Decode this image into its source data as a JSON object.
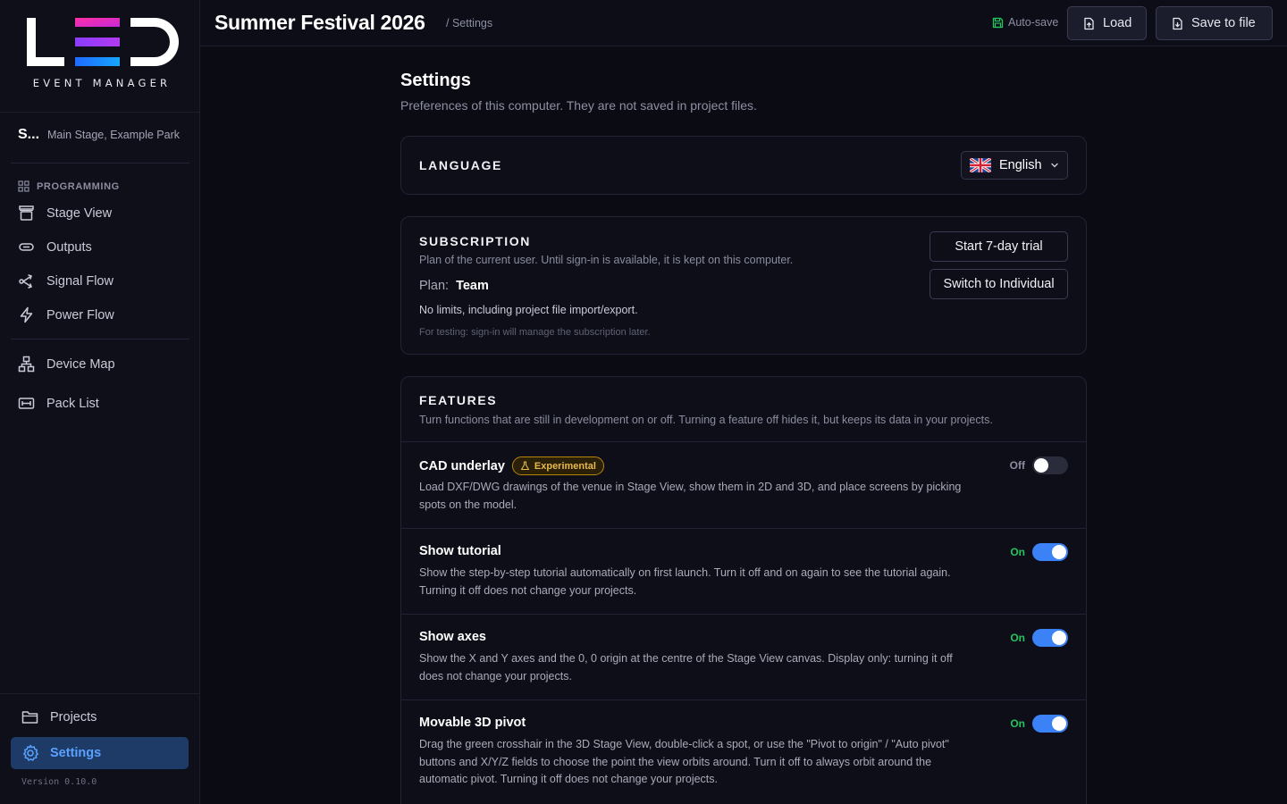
{
  "brand": {
    "logo_text": "LED",
    "logo_subtitle": "EVENT MANAGER"
  },
  "sidebar": {
    "project_name": "S...",
    "project_location": "Main Stage, Example Park",
    "section_label": "PROGRAMMING",
    "items": [
      {
        "label": "Stage View",
        "icon": "stage-icon"
      },
      {
        "label": "Outputs",
        "icon": "output-icon"
      },
      {
        "label": "Signal Flow",
        "icon": "signal-flow-icon"
      },
      {
        "label": "Power Flow",
        "icon": "lightning-icon"
      },
      {
        "label": "Device Map",
        "icon": "device-map-icon"
      },
      {
        "label": "Pack List",
        "icon": "pack-list-icon"
      }
    ],
    "projects_label": "Projects",
    "settings_label": "Settings",
    "version": "Version 0.10.0"
  },
  "header": {
    "title": "Summer Festival 2026",
    "breadcrumb": "/ Settings",
    "autosave_label": "Auto-save",
    "load_label": "Load",
    "save_label": "Save to file"
  },
  "page": {
    "title": "Settings",
    "subtitle": "Preferences of this computer. They are not saved in project files."
  },
  "language": {
    "title": "LANGUAGE",
    "selected": "English"
  },
  "subscription": {
    "title": "SUBSCRIPTION",
    "description": "Plan of the current user. Until sign-in is available, it is kept on this computer.",
    "plan_label": "Plan:",
    "plan_value": "Team",
    "plan_note": "No limits, including project file import/export.",
    "testing_note": "For testing: sign-in will manage the subscription later.",
    "trial_button": "Start 7-day trial",
    "switch_button": "Switch to Individual"
  },
  "features": {
    "title": "FEATURES",
    "description": "Turn functions that are still in development on or off. Turning a feature off hides it, but keeps its data in your projects.",
    "items": [
      {
        "title": "CAD underlay",
        "badge": "Experimental",
        "description": "Load DXF/DWG drawings of the venue in Stage View, show them in 2D and 3D, and place screens by picking spots on the model.",
        "state_label": "Off",
        "enabled": false
      },
      {
        "title": "Show tutorial",
        "description": "Show the step-by-step tutorial automatically on first launch. Turn it off and on again to see the tutorial again. Turning it off does not change your projects.",
        "state_label": "On",
        "enabled": true
      },
      {
        "title": "Show axes",
        "description": "Show the X and Y axes and the 0, 0 origin at the centre of the Stage View canvas. Display only: turning it off does not change your projects.",
        "state_label": "On",
        "enabled": true
      },
      {
        "title": "Movable 3D pivot",
        "description": "Drag the green crosshair in the 3D Stage View, double-click a spot, or use the \"Pivot to origin\" / \"Auto pivot\" buttons and X/Y/Z fields to choose the point the view orbits around. Turn it off to always orbit around the automatic pivot. Turning it off does not change your projects.",
        "state_label": "On",
        "enabled": true
      }
    ]
  },
  "colors": {
    "accent": "#3b82f6",
    "on_label": "#22c55e",
    "off_label": "#8a8da0",
    "badge": "#e8b84a"
  }
}
